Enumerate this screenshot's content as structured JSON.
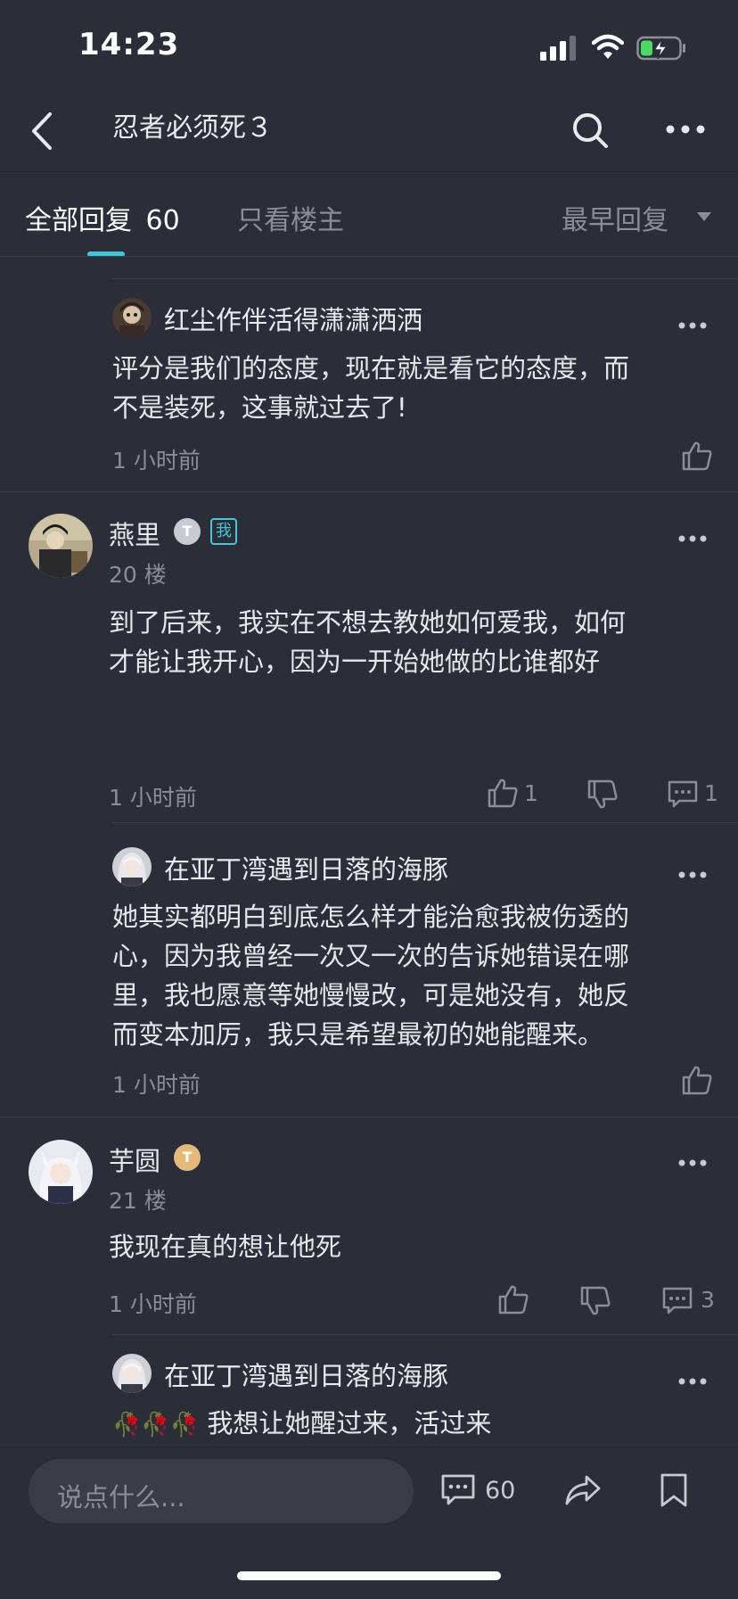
{
  "status_bar": {
    "time": "14:23"
  },
  "nav": {
    "title": "忍者必须死３"
  },
  "tabs": {
    "all": "全部回复",
    "all_count": "60",
    "owner_only": "只看楼主",
    "sort": "最早回复"
  },
  "replies": [
    {
      "name": "红尘作伴活得潇潇洒洒",
      "lines": [
        "评分是我们的态度，现在就是看它的态度，而",
        "不是装死，这事就过去了!"
      ],
      "time": "1 小时前"
    },
    {
      "name": "燕里",
      "level_badge": "T",
      "me_badge": "我",
      "floor": "20 楼",
      "lines": [
        "到了后来，我实在不想去教她如何爱我，如何",
        "才能让我开心，因为一开始她做的比谁都好"
      ],
      "time": "1 小时前",
      "likes": "1",
      "comments": "1"
    },
    {
      "name": "在亚丁湾遇到日落的海豚",
      "lines": [
        "她其实都明白到底怎么样才能治愈我被伤透的",
        "心，因为我曾经一次又一次的告诉她错误在哪",
        "里，我也愿意等她慢慢改，可是她没有，她反",
        "而变本加厉，我只是希望最初的她能醒来。"
      ],
      "time": "1 小时前"
    },
    {
      "name": "芋圆",
      "level_badge": "T",
      "floor": "21 楼",
      "lines": [
        "我现在真的想让他死"
      ],
      "time": "1 小时前",
      "comments": "3"
    },
    {
      "name": "在亚丁湾遇到日落的海豚",
      "lines": [
        "我想让她醒过来，活过来"
      ],
      "emoji": "🥀🥀🥀"
    }
  ],
  "bottom_bar": {
    "placeholder": "说点什么...",
    "comment_count": "60"
  },
  "colors": {
    "background": "#2b2e38",
    "accent": "#43c7d6",
    "muted_text": "#8a8d96",
    "input_bg": "#3a3d48"
  }
}
